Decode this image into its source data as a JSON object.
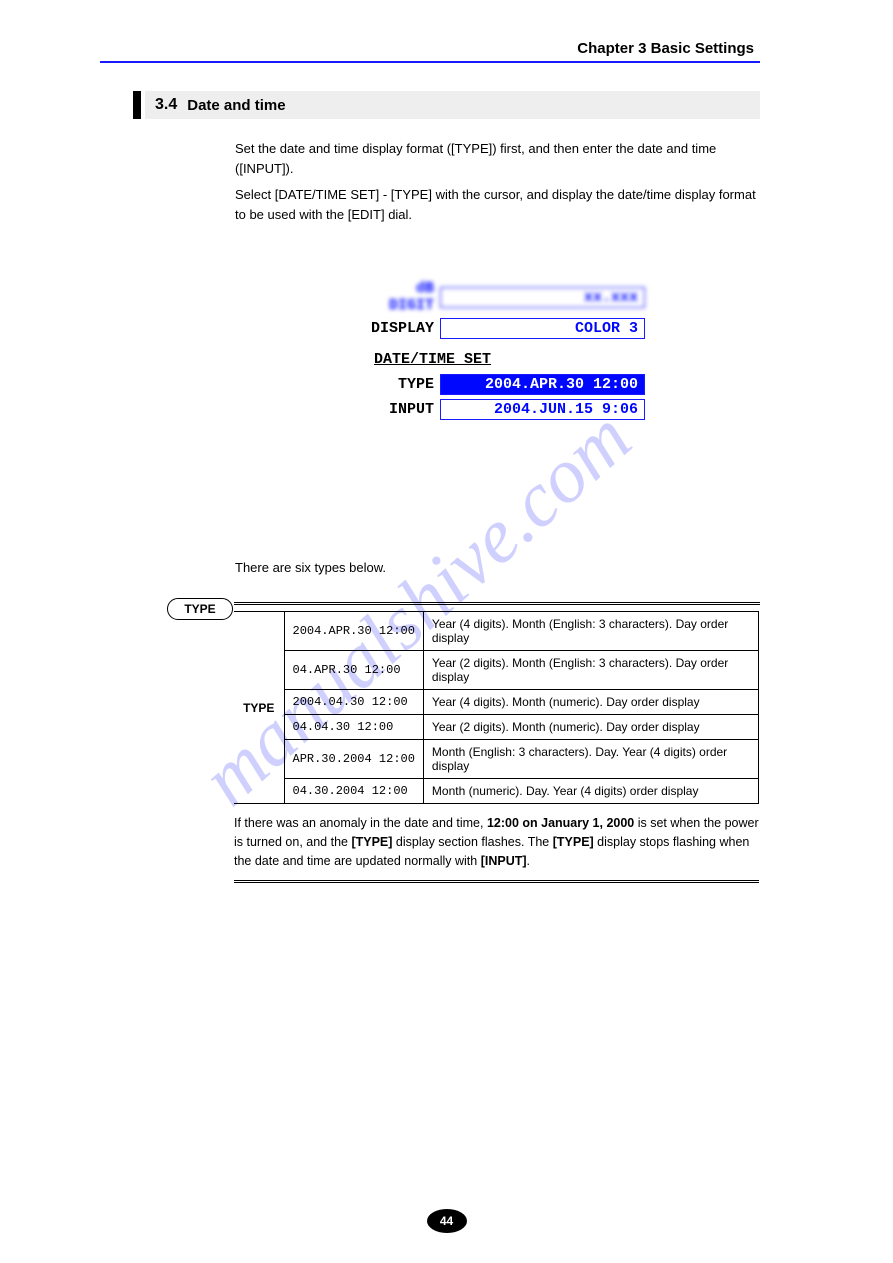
{
  "chapter_title": "Chapter 3 Basic Settings",
  "section": {
    "num": "3.4",
    "title": "Date and time"
  },
  "intro_paragraphs": [
    "Set the date and time display format ([TYPE]) first, and then enter the date and time ([INPUT]).",
    "Select [DATE/TIME SET] - [TYPE] with the cursor, and display the date/time display format to be used with the [EDIT] dial."
  ],
  "device": {
    "top_row_label": "dB DIGIT",
    "top_row_value": "xx.xxx",
    "display_label": "DISPLAY",
    "display_value": "COLOR 3",
    "group_label": "DATE/TIME SET",
    "type_label": "TYPE",
    "type_value": "2004.APR.30  12:00",
    "input_label": "INPUT",
    "input_value": "2004.JUN.15   9:06"
  },
  "after_paragraph": "There are six types below.",
  "type_capsule": "TYPE",
  "types_side_label": "TYPE",
  "type_rows": [
    {
      "fmt": "2004.APR.30",
      "time": "12:00",
      "desc": "Year (4 digits). Month (English: 3 characters). Day order display"
    },
    {
      "fmt": "04.APR.30",
      "time": "12:00",
      "desc": "Year (2 digits). Month (English: 3 characters). Day order display"
    },
    {
      "fmt": "2004.04.30",
      "time": "12:00",
      "desc": "Year (4 digits). Month (numeric). Day order display"
    },
    {
      "fmt": "04.04.30",
      "time": "12:00",
      "desc": "Year (2 digits). Month (numeric). Day order display"
    },
    {
      "fmt": "APR.30.2004",
      "time": "12:00",
      "desc": "Month (English: 3 characters). Day. Year (4 digits) order display"
    },
    {
      "fmt": "04.30.2004",
      "time": "12:00",
      "desc": "Month (numeric). Day. Year (4 digits) order display"
    }
  ],
  "note_html_parts": [
    "If there was an anomaly in the date and time, ",
    "12:00 on January 1, 2000",
    " is set when the power is turned on, and the ",
    "[TYPE]",
    " display section flashes. The ",
    "[TYPE]",
    " display stops flashing when the date and time are updated normally with ",
    "[INPUT]",
    "."
  ],
  "page_number": "44"
}
